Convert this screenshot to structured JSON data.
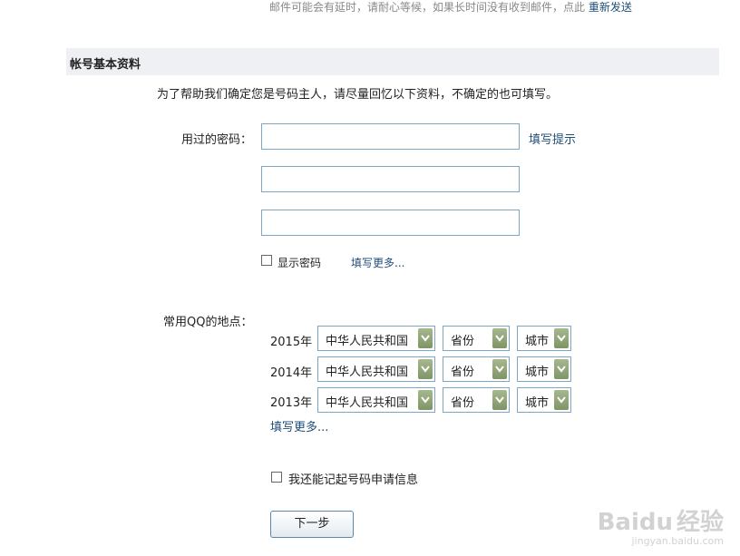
{
  "notice": {
    "text": "邮件可能会有延时，请耐心等候，如果长时间没有收到邮件，点此",
    "resend_link": "重新发送"
  },
  "section": {
    "title": "帐号基本资料"
  },
  "intro": "为了帮助我们确定您是号码主人，请尽量回忆以下资料，不确定的也可填写。",
  "password": {
    "label": "用过的密码：",
    "hint_link": "填写提示",
    "show_label": "显示密码",
    "more_link": "填写更多..."
  },
  "location": {
    "label": "常用QQ的地点：",
    "rows": [
      {
        "year": "2015年",
        "country": "中华人民共和国",
        "province": "省份",
        "city": "城市"
      },
      {
        "year": "2014年",
        "country": "中华人民共和国",
        "province": "省份",
        "city": "城市"
      },
      {
        "year": "2013年",
        "country": "中华人民共和国",
        "province": "省份",
        "city": "城市"
      }
    ],
    "more_link": "填写更多..."
  },
  "remember": {
    "label": "我还能记起号码申请信息"
  },
  "next_button": "下一步",
  "watermark": {
    "brand": "Baidu",
    "brand_cn": "经验",
    "url": "jingyan.baidu.com"
  }
}
